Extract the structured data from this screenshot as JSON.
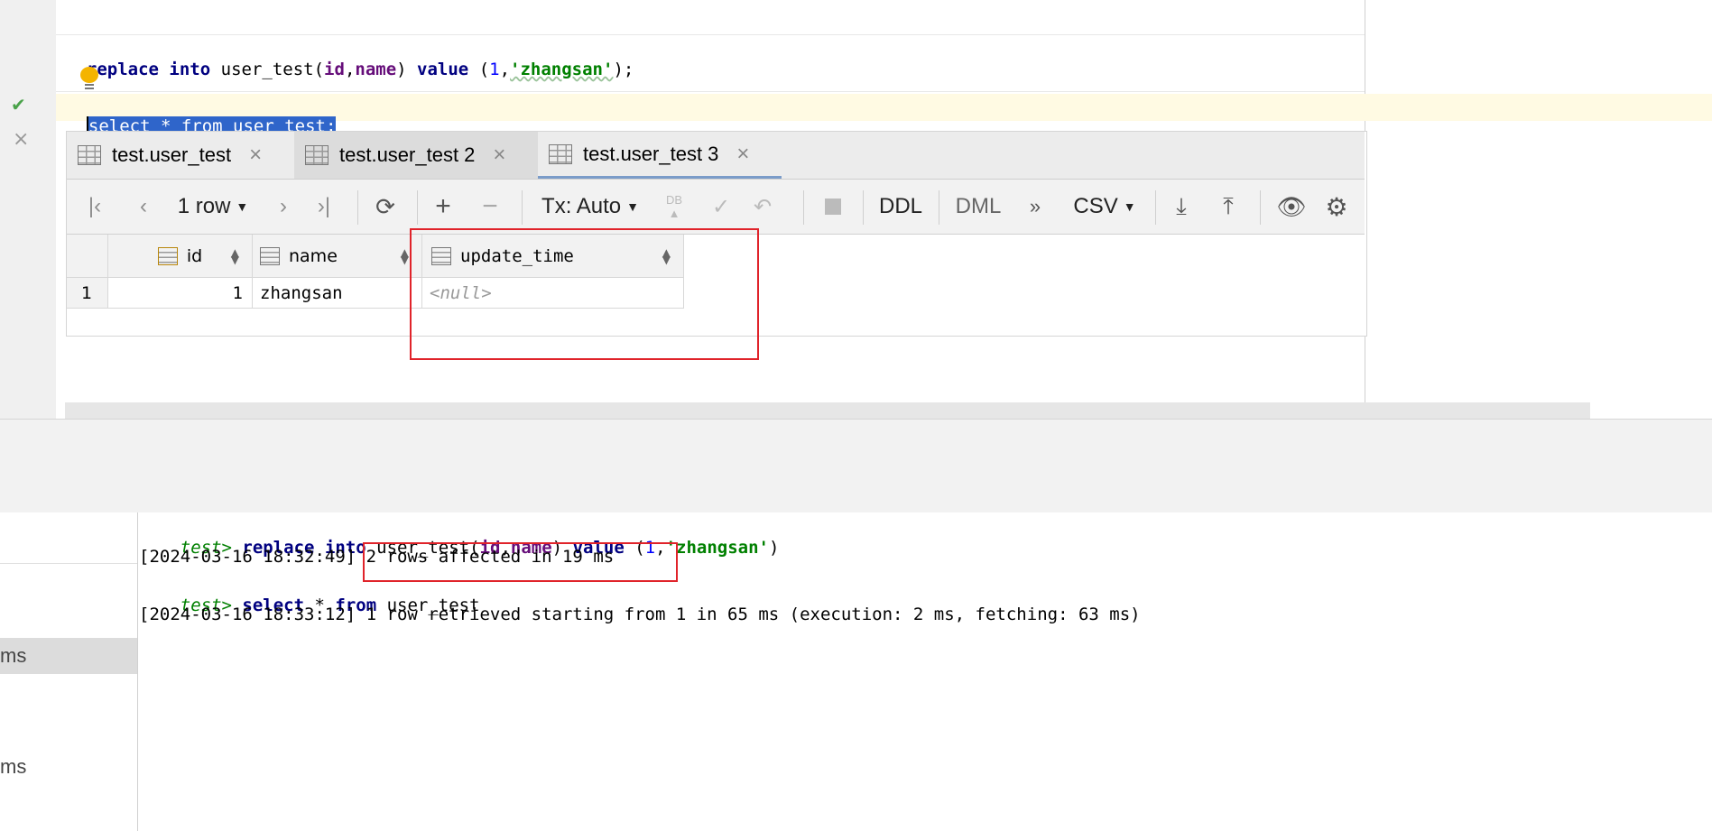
{
  "editor": {
    "line1": {
      "kw1": "replace",
      "kw2": "into",
      "table": "user_test",
      "col1": "id",
      "col2": "name",
      "kw3": "value",
      "num": "1",
      "str": "'zhangsan'",
      "tail": ");"
    },
    "line2": {
      "text": "select * from user_test;"
    },
    "gutter": {
      "success_mark": "✔",
      "close_mark": "×"
    }
  },
  "results": {
    "tabs": [
      {
        "label": "test.user_test"
      },
      {
        "label": "test.user_test 2"
      },
      {
        "label": "test.user_test 3"
      }
    ],
    "toolbar": {
      "rows": "1 row",
      "tx": "Tx: Auto",
      "db": "DB",
      "ddl": "DDL",
      "dml": "DML",
      "more": "»",
      "format": "CSV"
    },
    "columns": [
      "id",
      "name",
      "update_time"
    ],
    "rows": [
      {
        "num": "1",
        "id": "1",
        "name": "zhangsan",
        "update_time": "<null>"
      }
    ]
  },
  "console": {
    "lines": [
      {
        "prompt": "test>",
        "kw1": "replace",
        "kw2": "into",
        "rest1": " user_test(",
        "c1": "id",
        ",": ",",
        "c2": "name",
        "rest2": ") ",
        "kw3": "value",
        "rest3": " (",
        "num": "1",
        ",2": ",",
        "str": "'zhangsan'",
        "end": ")"
      },
      {
        "text": "[2024-03-16 18:32:49] 2 rows affected in 19 ms"
      },
      {
        "prompt": "test>",
        "kw1": "select",
        "rest1": " * ",
        "kw2": "from",
        "rest2": " user_test"
      },
      {
        "text": "[2024-03-16 18:33:12] 1 row retrieved starting from 1 in 65 ms (execution: 2 ms, fetching: 63 ms)"
      }
    ]
  },
  "left_panel": {
    "item1": "ms",
    "item2": "ms"
  },
  "colors": {
    "accent": "#2f65ca",
    "highlight_box": "#e0232a",
    "keyword": "#000080",
    "string": "#008000",
    "prompt": "#008000"
  }
}
